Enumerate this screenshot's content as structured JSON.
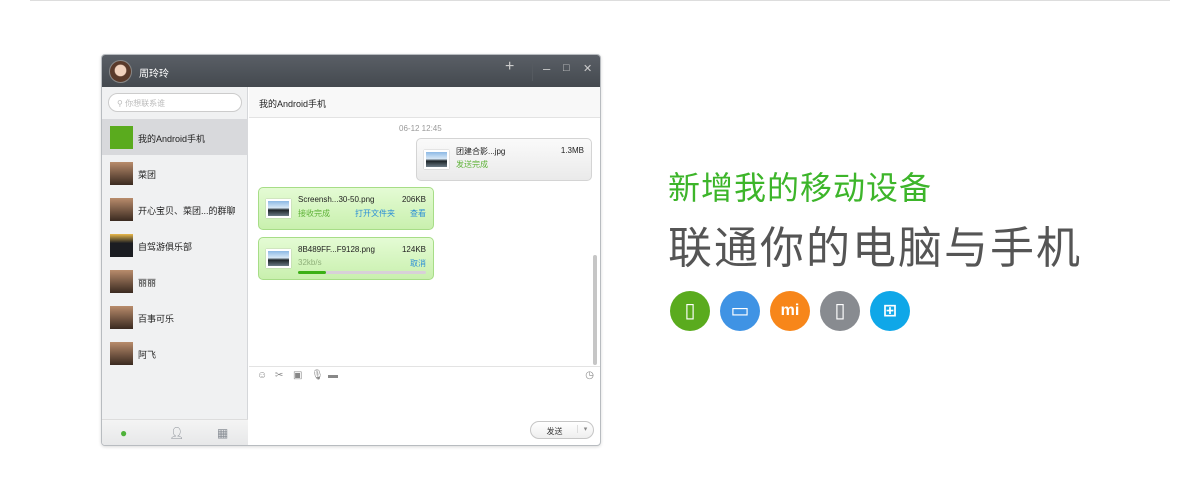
{
  "window": {
    "user_name": "周玲玲",
    "add_icon": "+",
    "min_icon": "–",
    "max_icon": "□",
    "close_icon": "✕"
  },
  "sidebar": {
    "search_placeholder": "你想联系谁",
    "items": [
      {
        "label": "我的Android手机"
      },
      {
        "label": "菜团"
      },
      {
        "label": "开心宝贝、菜团...的群聊"
      },
      {
        "label": "自驾游俱乐部"
      },
      {
        "label": "丽丽"
      },
      {
        "label": "百事可乐"
      },
      {
        "label": "阿飞"
      }
    ]
  },
  "chat": {
    "title": "我的Android手机",
    "timestamp": "06-12 12:45",
    "messages": [
      {
        "file": "团建合影...jpg",
        "size": "1.3MB",
        "status": "发送完成"
      },
      {
        "file": "Screensh...30-50.png",
        "size": "206KB",
        "status": "接收完成",
        "open_folder": "打开文件夹",
        "view": "查看"
      },
      {
        "file": "8B489FF...F9128.png",
        "size": "124KB",
        "status": "32kb/s",
        "cancel": "取消",
        "progress": 0.22
      }
    ],
    "send_label": "发送",
    "send_dropdown": "▾"
  },
  "promo": {
    "headline": "新增我的移动设备",
    "subheadline": "联通你的电脑与手机",
    "devices": [
      {
        "name": "android",
        "color": "#5aab1e"
      },
      {
        "name": "pc",
        "color": "#3f93e4"
      },
      {
        "name": "mi",
        "label": "mi",
        "color": "#f7861a"
      },
      {
        "name": "ios",
        "color": "#888b90"
      },
      {
        "name": "windows",
        "color": "#0fa7e8"
      }
    ]
  }
}
